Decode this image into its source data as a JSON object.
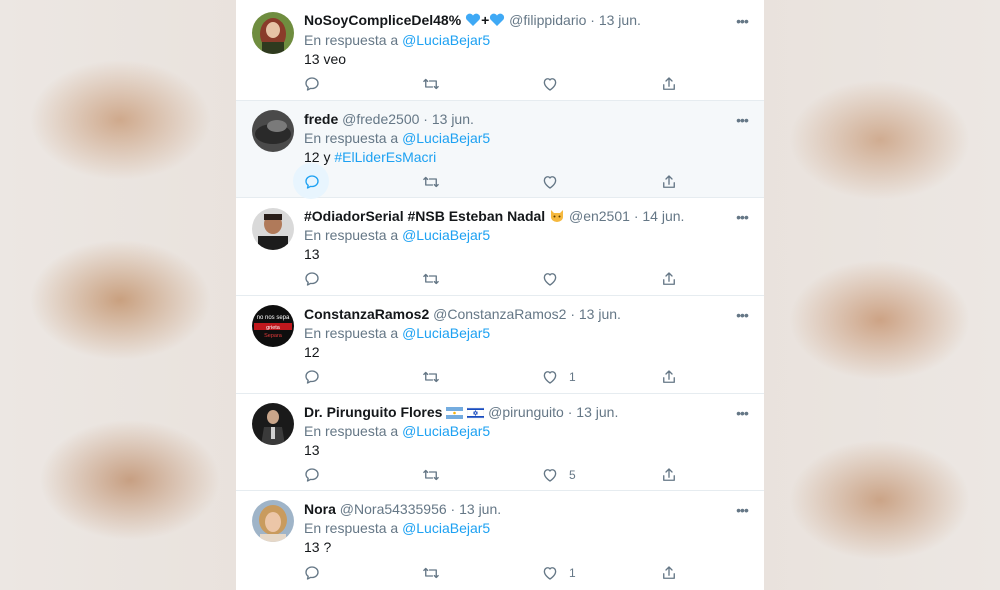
{
  "reply_prefix": "En respuesta a",
  "tweets": [
    {
      "name": "NoSoyCompliceDel48%",
      "handle": "@filippidario",
      "date": "13 jun.",
      "reply_to": "@LuciaBejar5",
      "text": "13 veo",
      "likes": "",
      "name_emoji": "blue-heart + blue-heart"
    },
    {
      "name": "frede",
      "handle": "@frede2500",
      "date": "13 jun.",
      "reply_to": "@LuciaBejar5",
      "text_prefix": "12 y ",
      "hashtag": "#ElLiderEsMacri",
      "likes": ""
    },
    {
      "name": "#OdiadorSerial #NSB Esteban Nadal",
      "handle": "@en2501",
      "date": "14 jun.",
      "reply_to": "@LuciaBejar5",
      "text": "13",
      "likes": "",
      "name_emoji": "cat-face"
    },
    {
      "name": "ConstanzaRamos2",
      "handle": "@ConstanzaRamos2",
      "date": "13 jun.",
      "reply_to": "@LuciaBejar5",
      "text": "12",
      "likes": "1",
      "avatar_text": [
        "no nos sepa",
        "grieta",
        "Separa"
      ]
    },
    {
      "name": "Dr. Pirunguito Flores",
      "handle": "@pirunguito",
      "date": "13 jun.",
      "reply_to": "@LuciaBejar5",
      "text": "13",
      "likes": "5",
      "name_emoji": "argentina-flag israel-flag"
    },
    {
      "name": "Nora",
      "handle": "@Nora54335956",
      "date": "13 jun.",
      "reply_to": "@LuciaBejar5",
      "text": "13 ?",
      "likes": "1"
    }
  ],
  "icons": {
    "reply": "reply-icon",
    "retweet": "retweet-icon",
    "like": "heart-icon",
    "share": "share-icon",
    "more": "more-icon"
  },
  "colors": {
    "link": "#1da1f2",
    "text": "#14171a",
    "muted": "#657786",
    "highlight_bg": "#f5f8fa"
  }
}
